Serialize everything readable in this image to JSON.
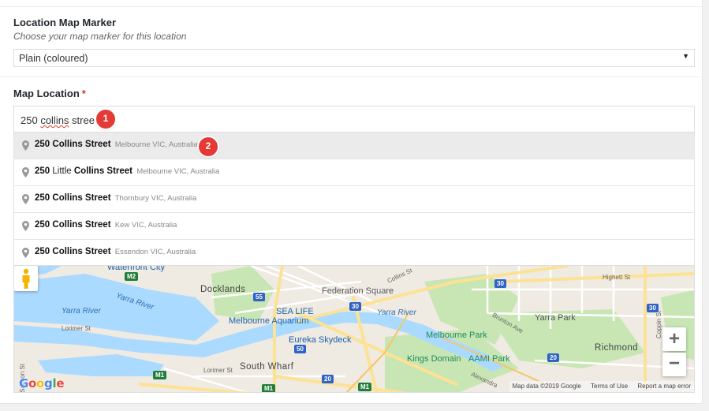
{
  "marker_field": {
    "label": "Location Map Marker",
    "description": "Choose your map marker for this location",
    "selected_value": "Plain (coloured)",
    "arrow": "▼"
  },
  "location_field": {
    "label": "Map Location",
    "required_mark": "*",
    "input_value_pre": "250 ",
    "input_value_misspelled": "collins",
    "input_value_post": " street"
  },
  "badges": [
    "1",
    "2"
  ],
  "suggestions": [
    {
      "bold1": "250",
      "middle": " ",
      "bold2": "Collins Street",
      "secondary": "Melbourne VIC, Australia"
    },
    {
      "bold1": "250",
      "middle": " Little ",
      "bold2": "Collins Street",
      "secondary": "Melbourne VIC, Australia"
    },
    {
      "bold1": "250",
      "middle": " ",
      "bold2": "Collins Street",
      "secondary": "Thornbury VIC, Australia"
    },
    {
      "bold1": "250",
      "middle": " ",
      "bold2": "Collins Street",
      "secondary": "Kew VIC, Australia"
    },
    {
      "bold1": "250",
      "middle": " ",
      "bold2": "Collins Street",
      "secondary": "Essendon VIC, Australia"
    }
  ],
  "map": {
    "labels": {
      "waterfront": "Waterfront City",
      "docklands": "Docklands",
      "federation": "Federation Square",
      "sealife1": "SEA LIFE",
      "sealife2": "Melbourne Aquarium",
      "yarra1": "Yarra River",
      "yarra2": "Yarra River",
      "yarra3": "Yarra River",
      "lorimer1": "Lorimer St",
      "lorimer2": "Lorimer St",
      "eureka": "Eureka Skydeck",
      "melbpark": "Melbourne Park",
      "kingsdomain": "Kings Domain",
      "aami": "AAMI Park",
      "southwharf": "South Wharf",
      "yarrapark": "Yarra Park",
      "richmond": "Richmond",
      "collinsst": "Collins St",
      "highett": "Highett St",
      "brunton": "Brunton Ave",
      "coppin": "Coppin St",
      "salmon": "Salmon St",
      "alexandra": "Alexandra"
    },
    "shields": {
      "m2": "M2",
      "r55": "55",
      "r30a": "30",
      "r30b": "30",
      "r50": "50",
      "m1a": "M1",
      "m1b": "M1",
      "m1c": "M1",
      "r20": "20",
      "r30c": "30",
      "r20b": "20"
    },
    "zoom_in": "+",
    "zoom_out": "−",
    "logo": {
      "G": "G",
      "o1": "o",
      "o2": "o",
      "g": "g",
      "l": "l",
      "e": "e"
    },
    "attribution": {
      "map_data": "Map data ©2019 Google",
      "terms": "Terms of Use",
      "report": "Report a map error"
    }
  },
  "colors": {
    "water": "#aadaff",
    "park": "#c8e6b4",
    "road_major": "#fde293",
    "badge_red": "#e53935",
    "required_red": "#dc3232"
  }
}
